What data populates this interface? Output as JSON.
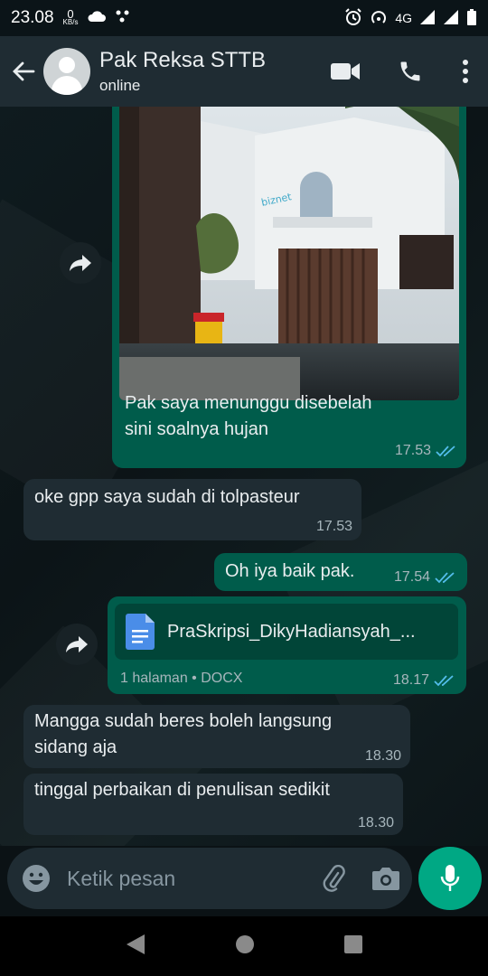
{
  "status_bar": {
    "time": "23.08",
    "speed_value": "0",
    "speed_unit": "KB/s",
    "network": "4G"
  },
  "header": {
    "contact_name": "Pak Reksa STTB",
    "contact_status": "online"
  },
  "messages": [
    {
      "direction": "outgoing",
      "type": "image",
      "caption": "Pak saya menunggu disebelah sini soalnya hujan",
      "caption_line1": "Pak saya menunggu disebelah",
      "caption_line2": "sini soalnya hujan",
      "time": "17.53",
      "read": true
    },
    {
      "direction": "incoming",
      "type": "text",
      "text": "oke gpp saya sudah di tolpasteur",
      "time": "17.53"
    },
    {
      "direction": "outgoing",
      "type": "text",
      "text": "Oh iya baik pak.",
      "time": "17.54",
      "read": true
    },
    {
      "direction": "outgoing",
      "type": "document",
      "file_name": "PraSkripsi_DikyHadiansyah_...",
      "file_info": "1 halaman • DOCX",
      "time": "18.17",
      "read": true
    },
    {
      "direction": "incoming",
      "type": "text",
      "text": "Mangga sudah beres boleh langsung sidang aja",
      "line1": "Mangga sudah beres boleh langsung",
      "line2": "sidang aja",
      "time": "18.30"
    },
    {
      "direction": "incoming",
      "type": "text",
      "text": "tinggal perbaikan di penulisan sedikit",
      "time": "18.30"
    }
  ],
  "composer": {
    "placeholder": "Ketik pesan"
  },
  "photo_sign": "biznet",
  "colors": {
    "outgoing_bubble": "#005c4b",
    "incoming_bubble": "#1f2c33",
    "accent": "#00a884",
    "read_ticks": "#53bdeb"
  }
}
